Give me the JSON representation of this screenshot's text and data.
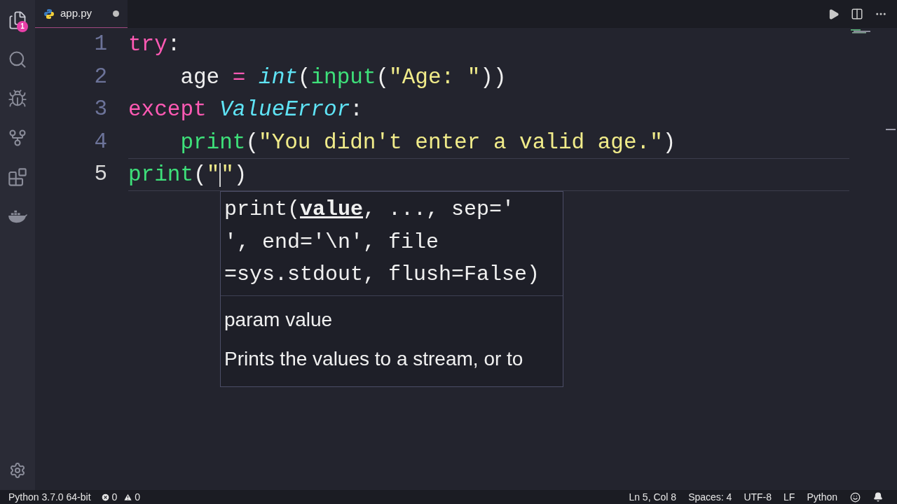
{
  "activity_bar": {
    "items": [
      {
        "kind": "files",
        "badge": "1"
      },
      {
        "kind": "search"
      },
      {
        "kind": "debug"
      },
      {
        "kind": "source_control"
      },
      {
        "kind": "extensions"
      },
      {
        "kind": "docker"
      }
    ]
  },
  "tabs": [
    {
      "label": "app.py",
      "selected": true,
      "modified": true
    }
  ],
  "editor": {
    "lines": [
      {
        "number": "1",
        "current": false,
        "tokens": [
          {
            "kind": "keyword",
            "text": "try"
          },
          {
            "kind": "text",
            "text": ":"
          }
        ]
      },
      {
        "number": "2",
        "current": false,
        "tokens": [
          {
            "kind": "text",
            "text": "    age "
          },
          {
            "kind": "op",
            "text": "="
          },
          {
            "kind": "type",
            "text": " int"
          },
          {
            "kind": "text",
            "text": "("
          },
          {
            "kind": "function",
            "text": "input"
          },
          {
            "kind": "text",
            "text": "("
          },
          {
            "kind": "string",
            "text": "\"Age: \""
          },
          {
            "kind": "text",
            "text": "))"
          }
        ]
      },
      {
        "number": "3",
        "current": false,
        "tokens": [
          {
            "kind": "keyword",
            "text": "except "
          },
          {
            "kind": "type",
            "text": "ValueError"
          },
          {
            "kind": "text",
            "text": ":"
          }
        ]
      },
      {
        "number": "4",
        "current": false,
        "tokens": [
          {
            "kind": "function",
            "text": "    print"
          },
          {
            "kind": "text",
            "text": "("
          },
          {
            "kind": "string",
            "text": "\"You didn't enter a valid age.\""
          },
          {
            "kind": "text",
            "text": ")"
          }
        ]
      },
      {
        "number": "5",
        "current": true,
        "tokens": [
          {
            "kind": "function",
            "text": "print"
          },
          {
            "kind": "text",
            "text": "("
          },
          {
            "kind": "string",
            "text": "\""
          },
          {
            "kind": "caret"
          },
          {
            "kind": "string",
            "text": "\""
          },
          {
            "kind": "text",
            "text": ")"
          }
        ]
      }
    ],
    "hover": {
      "signature": [
        [
          {
            "text": "print(",
            "active": false
          },
          {
            "text": "value",
            "active": true
          },
          {
            "text": ", ..., sep='",
            "active": false
          }
        ],
        [
          {
            "text": "', end='\\n', file",
            "active": false
          }
        ],
        [
          {
            "text": "=sys.stdout, flush=False)",
            "active": false
          }
        ]
      ],
      "param": "param value",
      "doc": "Prints the values to a stream, or to"
    }
  },
  "status_bar": {
    "interpreter": "Python 3.7.0 64-bit",
    "errors": "0",
    "warnings": "0",
    "position": "Ln 5, Col 8",
    "indent": "Spaces: 4",
    "encoding": "UTF-8",
    "eol": "LF",
    "language": "Python"
  }
}
